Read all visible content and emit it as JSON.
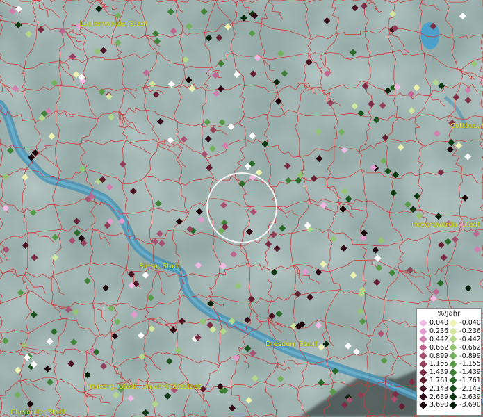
{
  "cities": [
    {
      "name": "Luckenwalde, Stadt"
    },
    {
      "name": "Cottbus, S"
    },
    {
      "name": "Hoyerswerda, Stadt"
    },
    {
      "name": "Riesa, Stadt"
    },
    {
      "name": "Dresden, Stadt"
    },
    {
      "name": "Freiberg, Stadt, Universitätsstadt"
    },
    {
      "name": "Chemnitz, Stadt"
    }
  ],
  "legend": {
    "title": "%/Jahr",
    "positive": [
      {
        "value": "0.040",
        "color": "#f2b8e4"
      },
      {
        "value": "0.236",
        "color": "#e29ccd"
      },
      {
        "value": "0.442",
        "color": "#d27fb0"
      },
      {
        "value": "0.662",
        "color": "#bf6590"
      },
      {
        "value": "0.899",
        "color": "#a8506f"
      },
      {
        "value": "1.155",
        "color": "#923e58"
      },
      {
        "value": "1.439",
        "color": "#7c2d44"
      },
      {
        "value": "1.761",
        "color": "#641e31"
      },
      {
        "value": "2.143",
        "color": "#4a1322"
      },
      {
        "value": "2.639",
        "color": "#320a15"
      },
      {
        "value": "3.690",
        "color": "#1c040b"
      }
    ],
    "negative": [
      {
        "value": "-0.040",
        "color": "#eef2b0"
      },
      {
        "value": "-0.236",
        "color": "#d2e79e"
      },
      {
        "value": "-0.442",
        "color": "#b4d88a"
      },
      {
        "value": "-0.662",
        "color": "#93c573"
      },
      {
        "value": "-0.899",
        "color": "#73b05c"
      },
      {
        "value": "-1.155",
        "color": "#579a48"
      },
      {
        "value": "-1.439",
        "color": "#3f8237"
      },
      {
        "value": "-1.761",
        "color": "#2a6a29"
      },
      {
        "value": "-2.143",
        "color": "#1a501c"
      },
      {
        "value": "-2.639",
        "color": "#0e3811"
      },
      {
        "value": "-3.690",
        "color": "#052107"
      }
    ]
  }
}
